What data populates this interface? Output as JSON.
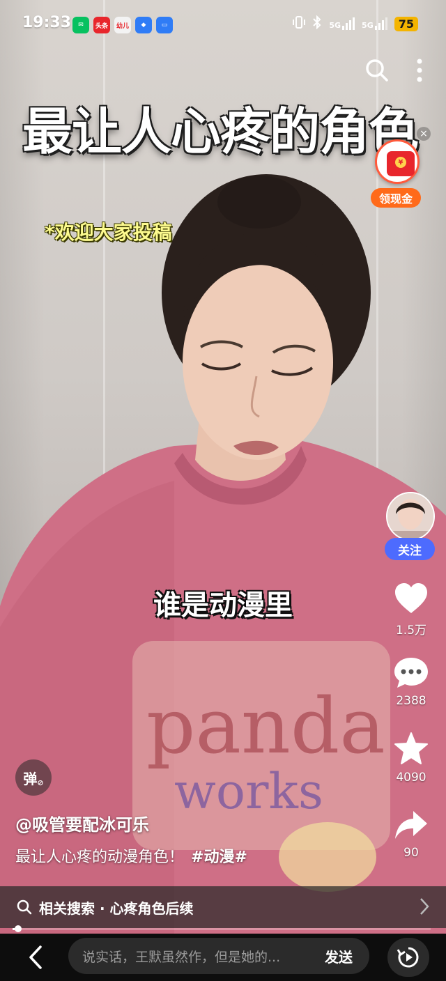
{
  "status_bar": {
    "time": "19:33",
    "apps": [
      {
        "name": "wechat-icon",
        "label": "",
        "color": "#07c160"
      },
      {
        "name": "toutiao-icon",
        "label": "头条",
        "color": "#e8262c"
      },
      {
        "name": "video-app-icon",
        "label": "幼儿",
        "color": "#e8262c"
      },
      {
        "name": "blue-app-icon",
        "label": "",
        "color": "#2f7cf6"
      },
      {
        "name": "cloud-app-icon",
        "label": "",
        "color": "#2f7cf6"
      }
    ],
    "signal1_label": "5G",
    "signal2_label": "5G",
    "battery": "75"
  },
  "video": {
    "title_overlay": "最让人心疼的角色",
    "welcome_text": "*欢迎大家投稿",
    "subtitle": "谁是动漫里"
  },
  "red_packet": {
    "label": "领现金",
    "coin_symbol": "¥",
    "close_symbol": "×"
  },
  "rail": {
    "follow_label": "关注",
    "like_count": "1.5万",
    "comment_count": "2388",
    "favorite_count": "4090",
    "share_count": "90"
  },
  "danmaku_label": "弹",
  "post": {
    "author": "@吸管要配冰可乐",
    "caption": "最让人心疼的动漫角色！",
    "hashtag": "#动漫#"
  },
  "related_search": {
    "text": "相关搜索 · 心疼角色后续"
  },
  "progress": {
    "fraction": 0.005
  },
  "bottom": {
    "comment_placeholder": "说实话，王默虽然作，但是她的...",
    "send_label": "发送"
  },
  "colors": {
    "follow_blue": "#4d6bfe",
    "red_packet_orange": "#ff6a1a",
    "welcome_yellow": "#fdfb8f"
  }
}
